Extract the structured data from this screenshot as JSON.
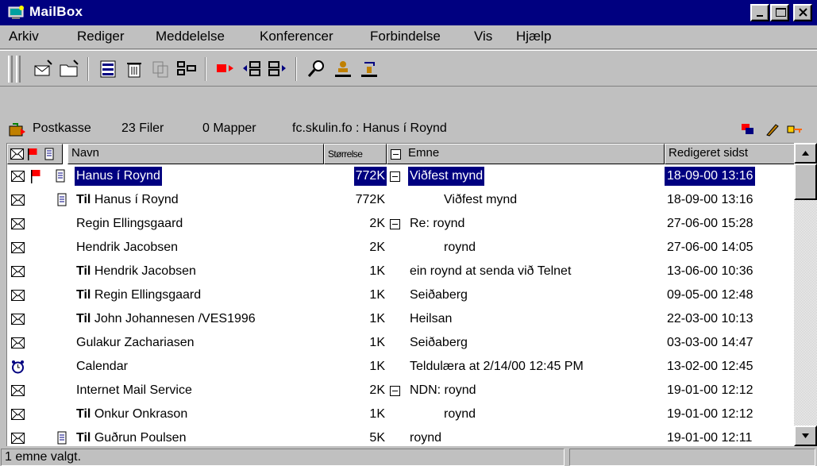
{
  "window": {
    "title": "MailBox"
  },
  "menu": [
    "Arkiv",
    "Rediger",
    "Meddelelse",
    "Konferencer",
    "Forbindelse",
    "Vis",
    "Hjælp"
  ],
  "path": {
    "folder": "Postkasse",
    "files": "23 Filer",
    "folders": "0 Mapper",
    "location": "fc.skulin.fo : Hanus í Roynd"
  },
  "columns": {
    "name": "Navn",
    "size": "Størrelse",
    "subject": "Emne",
    "edited": "Redigeret sidst"
  },
  "rows": [
    {
      "prefix": "",
      "name": "Hanus í Roynd",
      "size": "772K",
      "subject": "Viðfest mynd",
      "date": "18-09-00 13:16",
      "flag": true,
      "clip": true,
      "collapse": true,
      "selected": true,
      "indent": false,
      "icon": "mail-read-icon"
    },
    {
      "prefix": "Til",
      "name": "Hanus í Roynd",
      "size": "772K",
      "subject": "Viðfest mynd",
      "date": "18-09-00 13:16",
      "flag": false,
      "clip": true,
      "collapse": false,
      "selected": false,
      "indent": true,
      "icon": "mail-read-icon"
    },
    {
      "prefix": "",
      "name": "Regin Ellingsgaard",
      "size": "2K",
      "subject": "Re: roynd",
      "date": "27-06-00 15:28",
      "flag": false,
      "clip": false,
      "collapse": true,
      "selected": false,
      "indent": false,
      "icon": "mail-read-icon"
    },
    {
      "prefix": "",
      "name": "Hendrik Jacobsen",
      "size": "2K",
      "subject": "roynd",
      "date": "27-06-00 14:05",
      "flag": false,
      "clip": false,
      "collapse": false,
      "selected": false,
      "indent": true,
      "icon": "mail-read-icon"
    },
    {
      "prefix": "Til",
      "name": "Hendrik Jacobsen",
      "size": "1K",
      "subject": "ein roynd at senda við Telnet",
      "date": "13-06-00 10:36",
      "flag": false,
      "clip": false,
      "collapse": false,
      "selected": false,
      "indent": false,
      "icon": "mail-read-icon"
    },
    {
      "prefix": "Til",
      "name": "Regin Ellingsgaard",
      "size": "1K",
      "subject": "Seiðaberg",
      "date": "09-05-00 12:48",
      "flag": false,
      "clip": false,
      "collapse": false,
      "selected": false,
      "indent": false,
      "icon": "mail-read-icon"
    },
    {
      "prefix": "Til",
      "name": "John Johannesen /VES1996",
      "size": "1K",
      "subject": "Heilsan",
      "date": "22-03-00 10:13",
      "flag": false,
      "clip": false,
      "collapse": false,
      "selected": false,
      "indent": false,
      "icon": "mail-read-icon"
    },
    {
      "prefix": "",
      "name": "Gulakur Zachariasen",
      "size": "1K",
      "subject": "Seiðaberg",
      "date": "03-03-00 14:47",
      "flag": false,
      "clip": false,
      "collapse": false,
      "selected": false,
      "indent": false,
      "icon": "mail-read-icon"
    },
    {
      "prefix": "",
      "name": "Calendar",
      "size": "1K",
      "subject": "Teldulæra at 2/14/00 12:45 PM",
      "date": "13-02-00 12:45",
      "flag": false,
      "clip": false,
      "collapse": false,
      "selected": false,
      "indent": false,
      "icon": "alarm-clock-icon"
    },
    {
      "prefix": "",
      "name": "Internet Mail Service",
      "size": "2K",
      "subject": "NDN: roynd",
      "date": "19-01-00 12:12",
      "flag": false,
      "clip": false,
      "collapse": true,
      "selected": false,
      "indent": false,
      "icon": "mail-read-icon"
    },
    {
      "prefix": "Til",
      "name": "Onkur Onkrason",
      "size": "1K",
      "subject": "roynd",
      "date": "19-01-00 12:12",
      "flag": false,
      "clip": false,
      "collapse": false,
      "selected": false,
      "indent": true,
      "icon": "mail-read-icon"
    },
    {
      "prefix": "Til",
      "name": "Guðrun Poulsen",
      "size": "5K",
      "subject": "roynd",
      "date": "19-01-00 12:11",
      "flag": false,
      "clip": true,
      "collapse": false,
      "selected": false,
      "indent": false,
      "icon": "mail-read-icon"
    }
  ],
  "status": {
    "text": "1 emne valgt."
  },
  "colors": {
    "titlebar": "#000080",
    "selection": "#000080",
    "face": "#c0c0c0",
    "flag": "#ff0000"
  }
}
